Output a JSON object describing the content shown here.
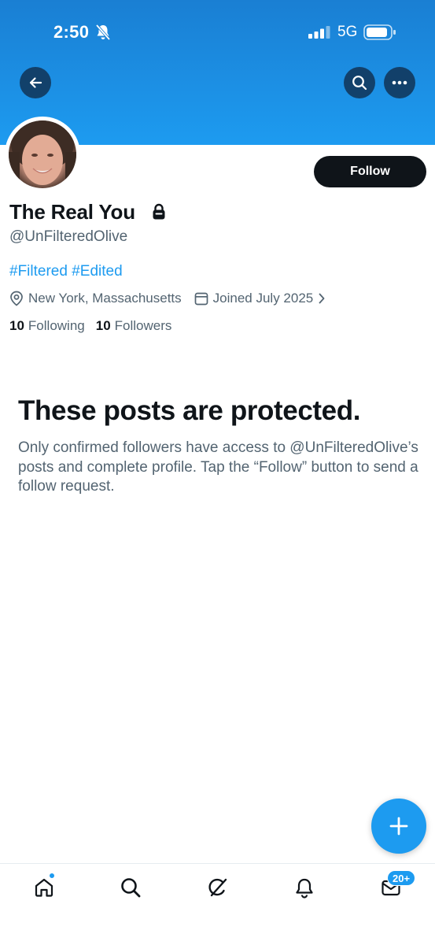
{
  "status_bar": {
    "time": "2:50",
    "network": "5G"
  },
  "profile": {
    "display_name": "The Real You",
    "handle": "@UnFilteredOlive",
    "bio": "#Filtered #Edited",
    "location": "New York, Massachusetts",
    "joined": "Joined July 2025",
    "following_count": "10",
    "following_label": "Following",
    "followers_count": "10",
    "followers_label": "Followers",
    "follow_button": "Follow"
  },
  "protected": {
    "title": "These posts are protected.",
    "body": "Only confirmed followers have access to @UnFilteredOlive’s posts and complete profile. Tap the “Follow” button to send a follow request."
  },
  "tabbar": {
    "items": [
      "home-icon",
      "search-icon",
      "grok-icon",
      "bell-icon",
      "mail-icon"
    ],
    "messages_badge": "20+"
  },
  "colors": {
    "accent": "#1d9bf0",
    "banner_top": "#1a7fd3",
    "text_primary": "#0f1419",
    "text_secondary": "#536471"
  }
}
